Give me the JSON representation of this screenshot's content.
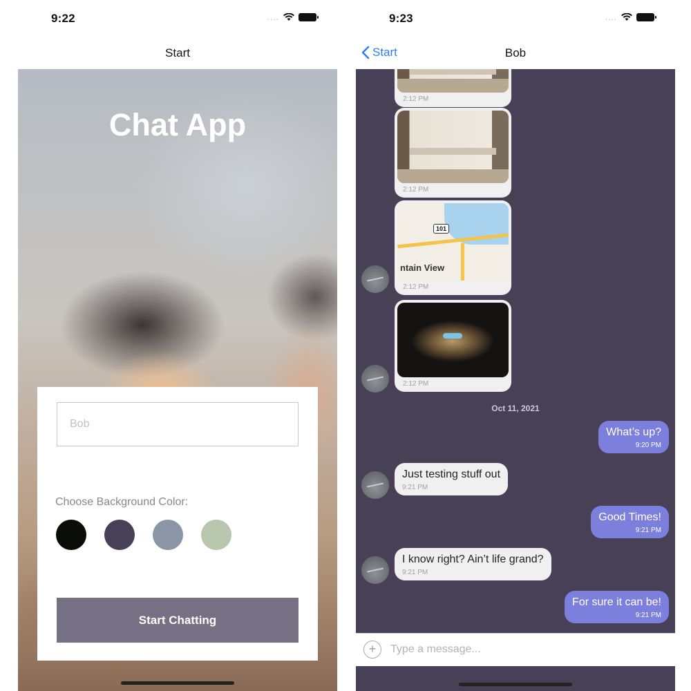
{
  "left_screen": {
    "status_time": "9:22",
    "nav_title": "Start",
    "app_title": "Chat App",
    "name_input": {
      "value": "",
      "placeholder": "Bob"
    },
    "color_label": "Choose Background Color:",
    "colors": [
      "#090C08",
      "#474056",
      "#8A95A5",
      "#B9C6AE"
    ],
    "start_button": "Start Chatting"
  },
  "right_screen": {
    "status_time": "9:23",
    "back_label": "Start",
    "nav_title": "Bob",
    "chat_bg": "#474056",
    "image_messages": [
      {
        "time": "2:12 PM",
        "kind": "photo"
      },
      {
        "time": "2:12 PM",
        "kind": "photo"
      },
      {
        "time": "2:12 PM",
        "kind": "map",
        "map_label": "ntain View",
        "route": "101"
      },
      {
        "time": "2:12 PM",
        "kind": "photo"
      }
    ],
    "date_separator": "Oct 11, 2021",
    "messages": [
      {
        "side": "out",
        "text": "What’s up?",
        "time": "9:20 PM"
      },
      {
        "side": "in",
        "text": "Just testing stuff out",
        "time": "9:21 PM"
      },
      {
        "side": "out",
        "text": "Good Times!",
        "time": "9:21 PM"
      },
      {
        "side": "in",
        "text": "I know right? Ain’t life grand?",
        "time": "9:21 PM"
      },
      {
        "side": "out",
        "text": "For sure it can be!",
        "time": "9:21 PM"
      }
    ],
    "composer": {
      "value": "",
      "placeholder": "Type a message..."
    }
  },
  "colors": {
    "accent_blue": "#2F7DF6",
    "outgoing_bubble": "#7D7FDC",
    "button": "#757083"
  }
}
